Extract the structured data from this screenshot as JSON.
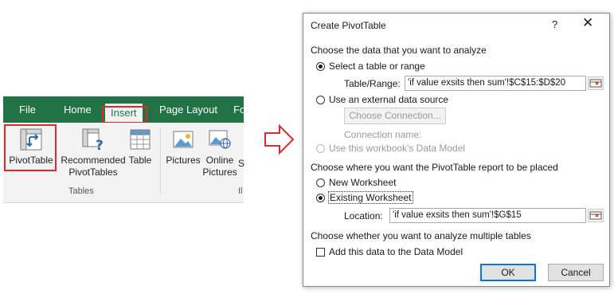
{
  "ribbon": {
    "tabs": [
      "File",
      "Home",
      "Insert",
      "Page Layout",
      "Fo"
    ],
    "buttons": {
      "pivot_table": "PivotTable",
      "recommended_line1": "Recommended",
      "recommended_line2": "PivotTables",
      "table": "Table",
      "pictures": "Pictures",
      "online_line1": "Online",
      "online_line2": "Pictures",
      "shapes_partial": "S"
    },
    "groups": {
      "tables": "Tables",
      "illustrations_partial": "Il"
    },
    "colors": {
      "tab_bar": "#217346",
      "highlight": "#e0282f"
    }
  },
  "dialog": {
    "title": "Create PivotTable",
    "help": "?",
    "close": "✕",
    "section1": "Choose the data that you want to analyze",
    "opt_select_table": "Select a table or range",
    "table_range_label": "Table/Range:",
    "table_range_value": "'if value exsits then sum'!$C$15:$D$20",
    "opt_external": "Use an external data source",
    "choose_connection": "Choose Connection...",
    "connection_name_label": "Connection name:",
    "opt_data_model": "Use this workbook's Data Model",
    "section2": "Choose where you want the PivotTable report to be placed",
    "opt_new_worksheet": "New Worksheet",
    "opt_existing_worksheet": "Existing Worksheet",
    "location_label": "Location:",
    "location_value": "'if value exsits then sum'!$G$15",
    "section3": "Choose whether you want to analyze multiple tables",
    "add_data_model": "Add this data to the Data Model",
    "ok": "OK",
    "cancel": "Cancel"
  }
}
